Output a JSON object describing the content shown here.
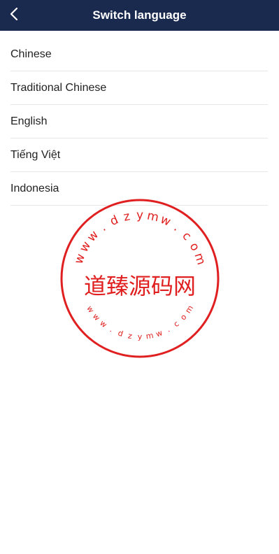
{
  "header": {
    "title": "Switch language",
    "back_icon": "chevron-left-icon"
  },
  "languages": [
    {
      "label": "Chinese"
    },
    {
      "label": "Traditional Chinese"
    },
    {
      "label": "English"
    },
    {
      "label": "Tiếng Việt"
    },
    {
      "label": "Indonesia"
    }
  ],
  "watermark": {
    "center_text": "道臻源码网",
    "upper_text": "www.dzymw.com",
    "lower_text": "www.dzymw.com",
    "color": "#e02020"
  },
  "colors": {
    "header_bg": "#1a2a4f",
    "header_text": "#ffffff",
    "item_text": "#222222",
    "divider": "#e6e6e6"
  }
}
